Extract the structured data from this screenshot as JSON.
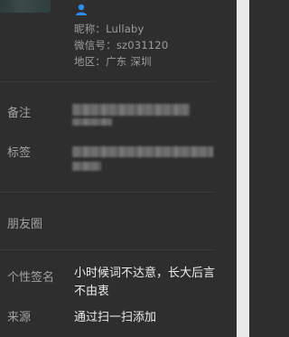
{
  "profile": {
    "nickname_label": "昵称：",
    "nickname": "Lullaby",
    "wechat_id_label": "微信号：",
    "wechat_id": "sz031120",
    "region_label": "地区：",
    "region": "广东 深圳",
    "gender_icon": "person-icon",
    "accent_color": "#2f8cf0"
  },
  "rows": {
    "remark_label": "备注",
    "tags_label": "标签",
    "moments_label": "朋友圈",
    "signature_label": "个性签名",
    "signature": "小时候词不达意，长大后言不由衷",
    "source_label": "来源",
    "source": "通过扫一扫添加"
  }
}
